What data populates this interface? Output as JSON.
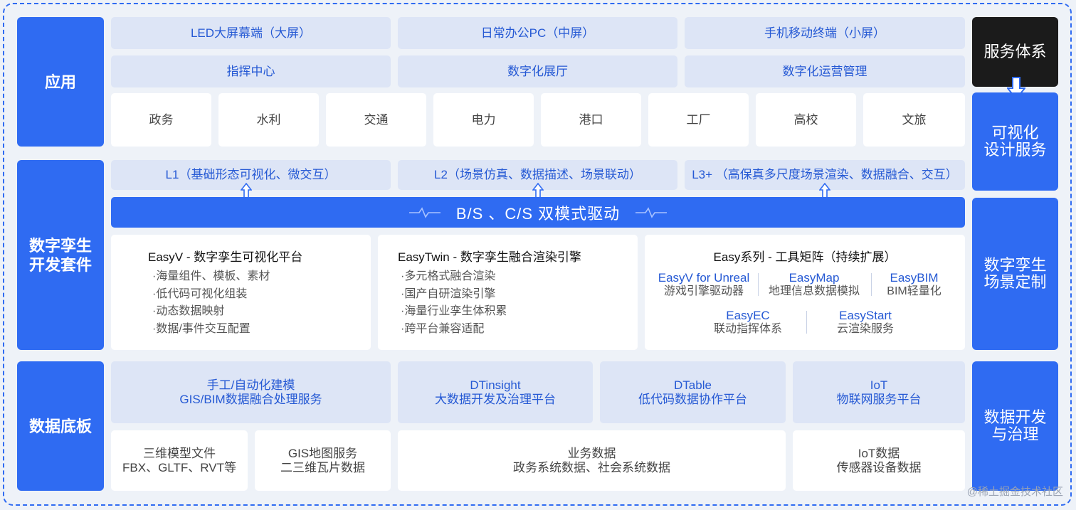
{
  "side_labels": {
    "app": "应用",
    "kit": "数字孪生\n开发套件",
    "data": "数据底板"
  },
  "services": {
    "system": "服务体系",
    "visual": "可视化\n设计服务",
    "scene": "数字孪生\n场景定制",
    "govern": "数据开发\n与治理"
  },
  "app": {
    "screens": [
      "LED大屏幕端（大屏）",
      "日常办公PC（中屏）",
      "手机移动终端（小屏）"
    ],
    "centers": [
      "指挥中心",
      "数字化展厅",
      "数字化运营管理"
    ],
    "industries": [
      "政务",
      "水利",
      "交通",
      "电力",
      "港口",
      "工厂",
      "高校",
      "文旅"
    ]
  },
  "levels": [
    "L1（基础形态可视化、微交互）",
    "L2（场景仿真、数据描述、场景联动）",
    "L3+ （高保真多尺度场景渲染、数据融合、交互）"
  ],
  "banner": "B/S 、C/S 双模式驱动",
  "kit": {
    "easyv": {
      "title": "EasyV - 数字孪生可视化平台",
      "features": [
        "·海量组件、模板、素材",
        "·低代码可视化组装",
        "·动态数据映射",
        "·数据/事件交互配置"
      ]
    },
    "easytwin": {
      "title": "EasyTwin - 数字孪生融合渲染引擎",
      "features": [
        "·多元格式融合渲染",
        "·国产自研渲染引擎",
        "·海量行业孪生体积累",
        "·跨平台兼容适配"
      ]
    },
    "easy": {
      "title": "Easy系列 - 工具矩阵（持续扩展）",
      "tools": [
        {
          "name": "EasyV for Unreal",
          "desc": "游戏引擎驱动器"
        },
        {
          "name": "EasyMap",
          "desc": "地理信息数据模拟"
        },
        {
          "name": "EasyBIM",
          "desc": "BIM轻量化"
        },
        {
          "name": "EasyEC",
          "desc": "联动指挥体系"
        },
        {
          "name": "EasyStart",
          "desc": "云渲染服务"
        }
      ]
    }
  },
  "data_layer": {
    "platforms": [
      "手工/自动化建模\nGIS/BIM数据融合处理服务",
      "DTinsight\n大数据开发及治理平台",
      "DTable\n低代码数据协作平台",
      "IoT\n物联网服务平台"
    ],
    "sources": [
      "三维模型文件\nFBX、GLTF、RVT等",
      "GIS地图服务\n二三维瓦片数据",
      "业务数据\n政务系统数据、社会系统数据",
      "IoT数据\n传感器设备数据"
    ]
  },
  "watermark": "@稀土掘金技术社区",
  "colors": {
    "accent": "#2f6bf2",
    "pale": "#dde5f6",
    "dark": "#1b1b1b"
  }
}
